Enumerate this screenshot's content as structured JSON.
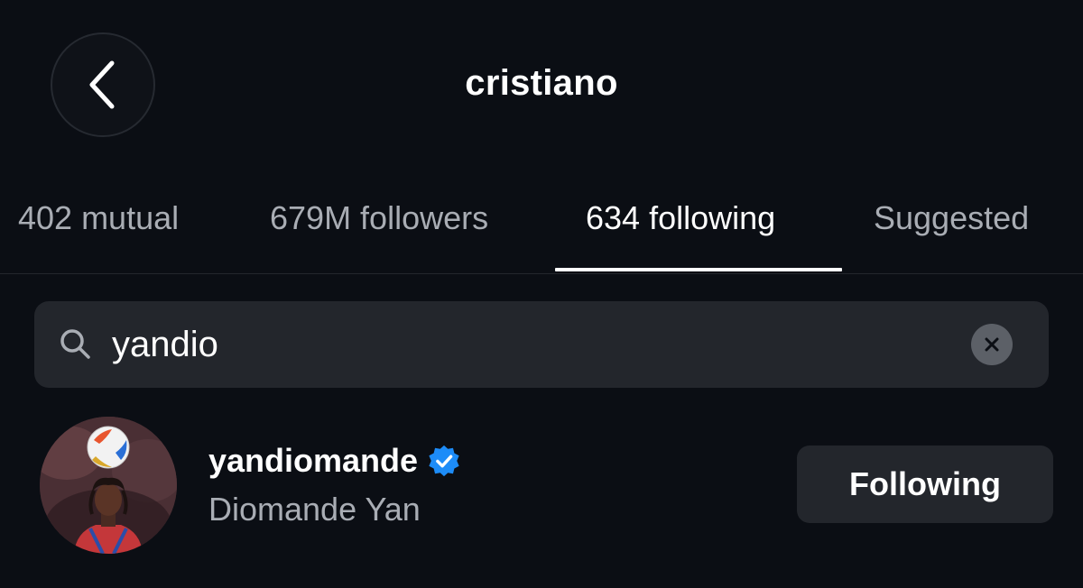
{
  "header": {
    "title": "cristiano",
    "back_icon": "chevron-left-icon"
  },
  "tabs": [
    {
      "label": "402 mutual",
      "active": false
    },
    {
      "label": "679M followers",
      "active": false
    },
    {
      "label": "634 following",
      "active": true
    },
    {
      "label": "Suggested",
      "active": false
    }
  ],
  "search": {
    "value": "yandio",
    "icon": "search-icon",
    "clear_icon": "clear-icon"
  },
  "results": [
    {
      "username": "yandiomande",
      "verified": true,
      "full_name": "Diomande Yan",
      "button_label": "Following"
    }
  ],
  "colors": {
    "background": "#0b0e14",
    "surface": "#23262c",
    "text_primary": "#ffffff",
    "text_secondary": "#a9adb4",
    "verified_blue": "#1d8cf8"
  }
}
